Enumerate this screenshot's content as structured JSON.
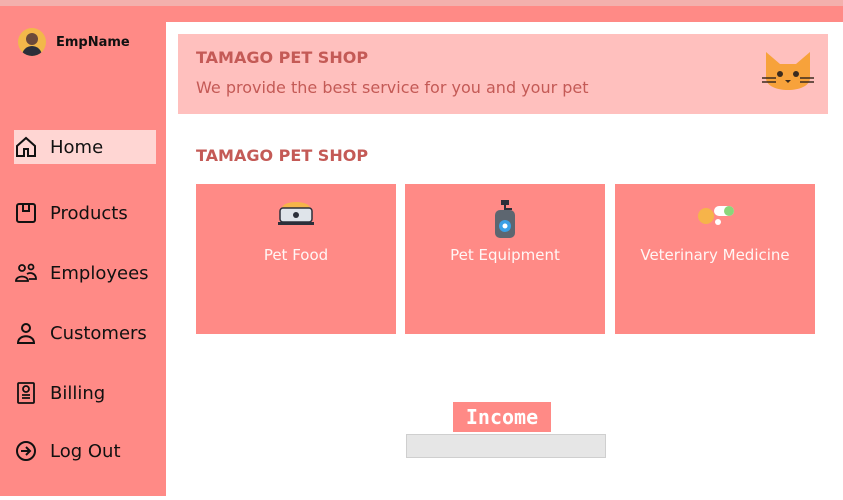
{
  "sidebar": {
    "user_name": "EmpName",
    "items": [
      {
        "label": "Home"
      },
      {
        "label": "Products"
      },
      {
        "label": "Employees"
      },
      {
        "label": "Customers"
      },
      {
        "label": "Billing"
      },
      {
        "label": "Log Out"
      }
    ]
  },
  "banner": {
    "title": "TAMAGO PET SHOP",
    "subtitle": "We provide the best service for you and your pet"
  },
  "section": {
    "title": "TAMAGO PET SHOP"
  },
  "cards": [
    {
      "label": "Pet Food"
    },
    {
      "label": "Pet Equipment"
    },
    {
      "label": "Veterinary Medicine"
    }
  ],
  "income": {
    "title": "Income",
    "value": ""
  },
  "colors": {
    "accent": "#ff8a86",
    "banner_bg": "#ffc0be",
    "title_text": "#c45a56"
  }
}
